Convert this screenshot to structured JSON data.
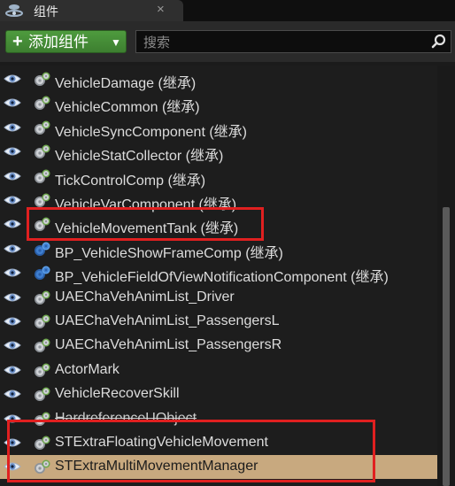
{
  "tab": {
    "title": "组件",
    "close_label": "×"
  },
  "toolbar": {
    "add_button_label": "添加组件",
    "add_button_plus": "+",
    "add_button_arrow": "▼",
    "search_placeholder": "搜索"
  },
  "components": [
    {
      "label": "VehicleDamage (继承)",
      "icon": "gear-icon"
    },
    {
      "label": "VehicleCommon (继承)",
      "icon": "gear-icon"
    },
    {
      "label": "VehicleSyncComponent (继承)",
      "icon": "gear-icon"
    },
    {
      "label": "VehicleStatCollector (继承)",
      "icon": "gear-icon"
    },
    {
      "label": "TickControlComp (继承)",
      "icon": "gear-icon"
    },
    {
      "label": "VehicleVarComponent (继承)",
      "icon": "gear-icon"
    },
    {
      "label": "VehicleMovementTank (继承)",
      "icon": "gear-icon"
    },
    {
      "label": "BP_VehicleShowFrameComp (继承)",
      "icon": "blueprint-gear-icon"
    },
    {
      "label": "BP_VehicleFieldOfViewNotificationComponent (继承)",
      "icon": "blueprint-gear-icon"
    },
    {
      "label": "UAEChaVehAnimList_Driver",
      "icon": "gear-icon"
    },
    {
      "label": "UAEChaVehAnimList_PassengersL",
      "icon": "gear-icon"
    },
    {
      "label": "UAEChaVehAnimList_PassengersR",
      "icon": "gear-icon"
    },
    {
      "label": "ActorMark",
      "icon": "gear-icon"
    },
    {
      "label": "VehicleRecoverSkill",
      "icon": "gear-icon"
    },
    {
      "label": "HardreferenceUObject",
      "icon": "gear-icon"
    },
    {
      "label": "STExtraFloatingVehicleMovement",
      "icon": "gear-icon"
    },
    {
      "label": "STExtraMultiMovementManager",
      "icon": "gear-icon",
      "selected": true
    }
  ],
  "colors": {
    "add_button": "#4e9b3e",
    "selection": "#c8a97f",
    "highlight": "#e02020",
    "eye": "#6a8fc8"
  }
}
